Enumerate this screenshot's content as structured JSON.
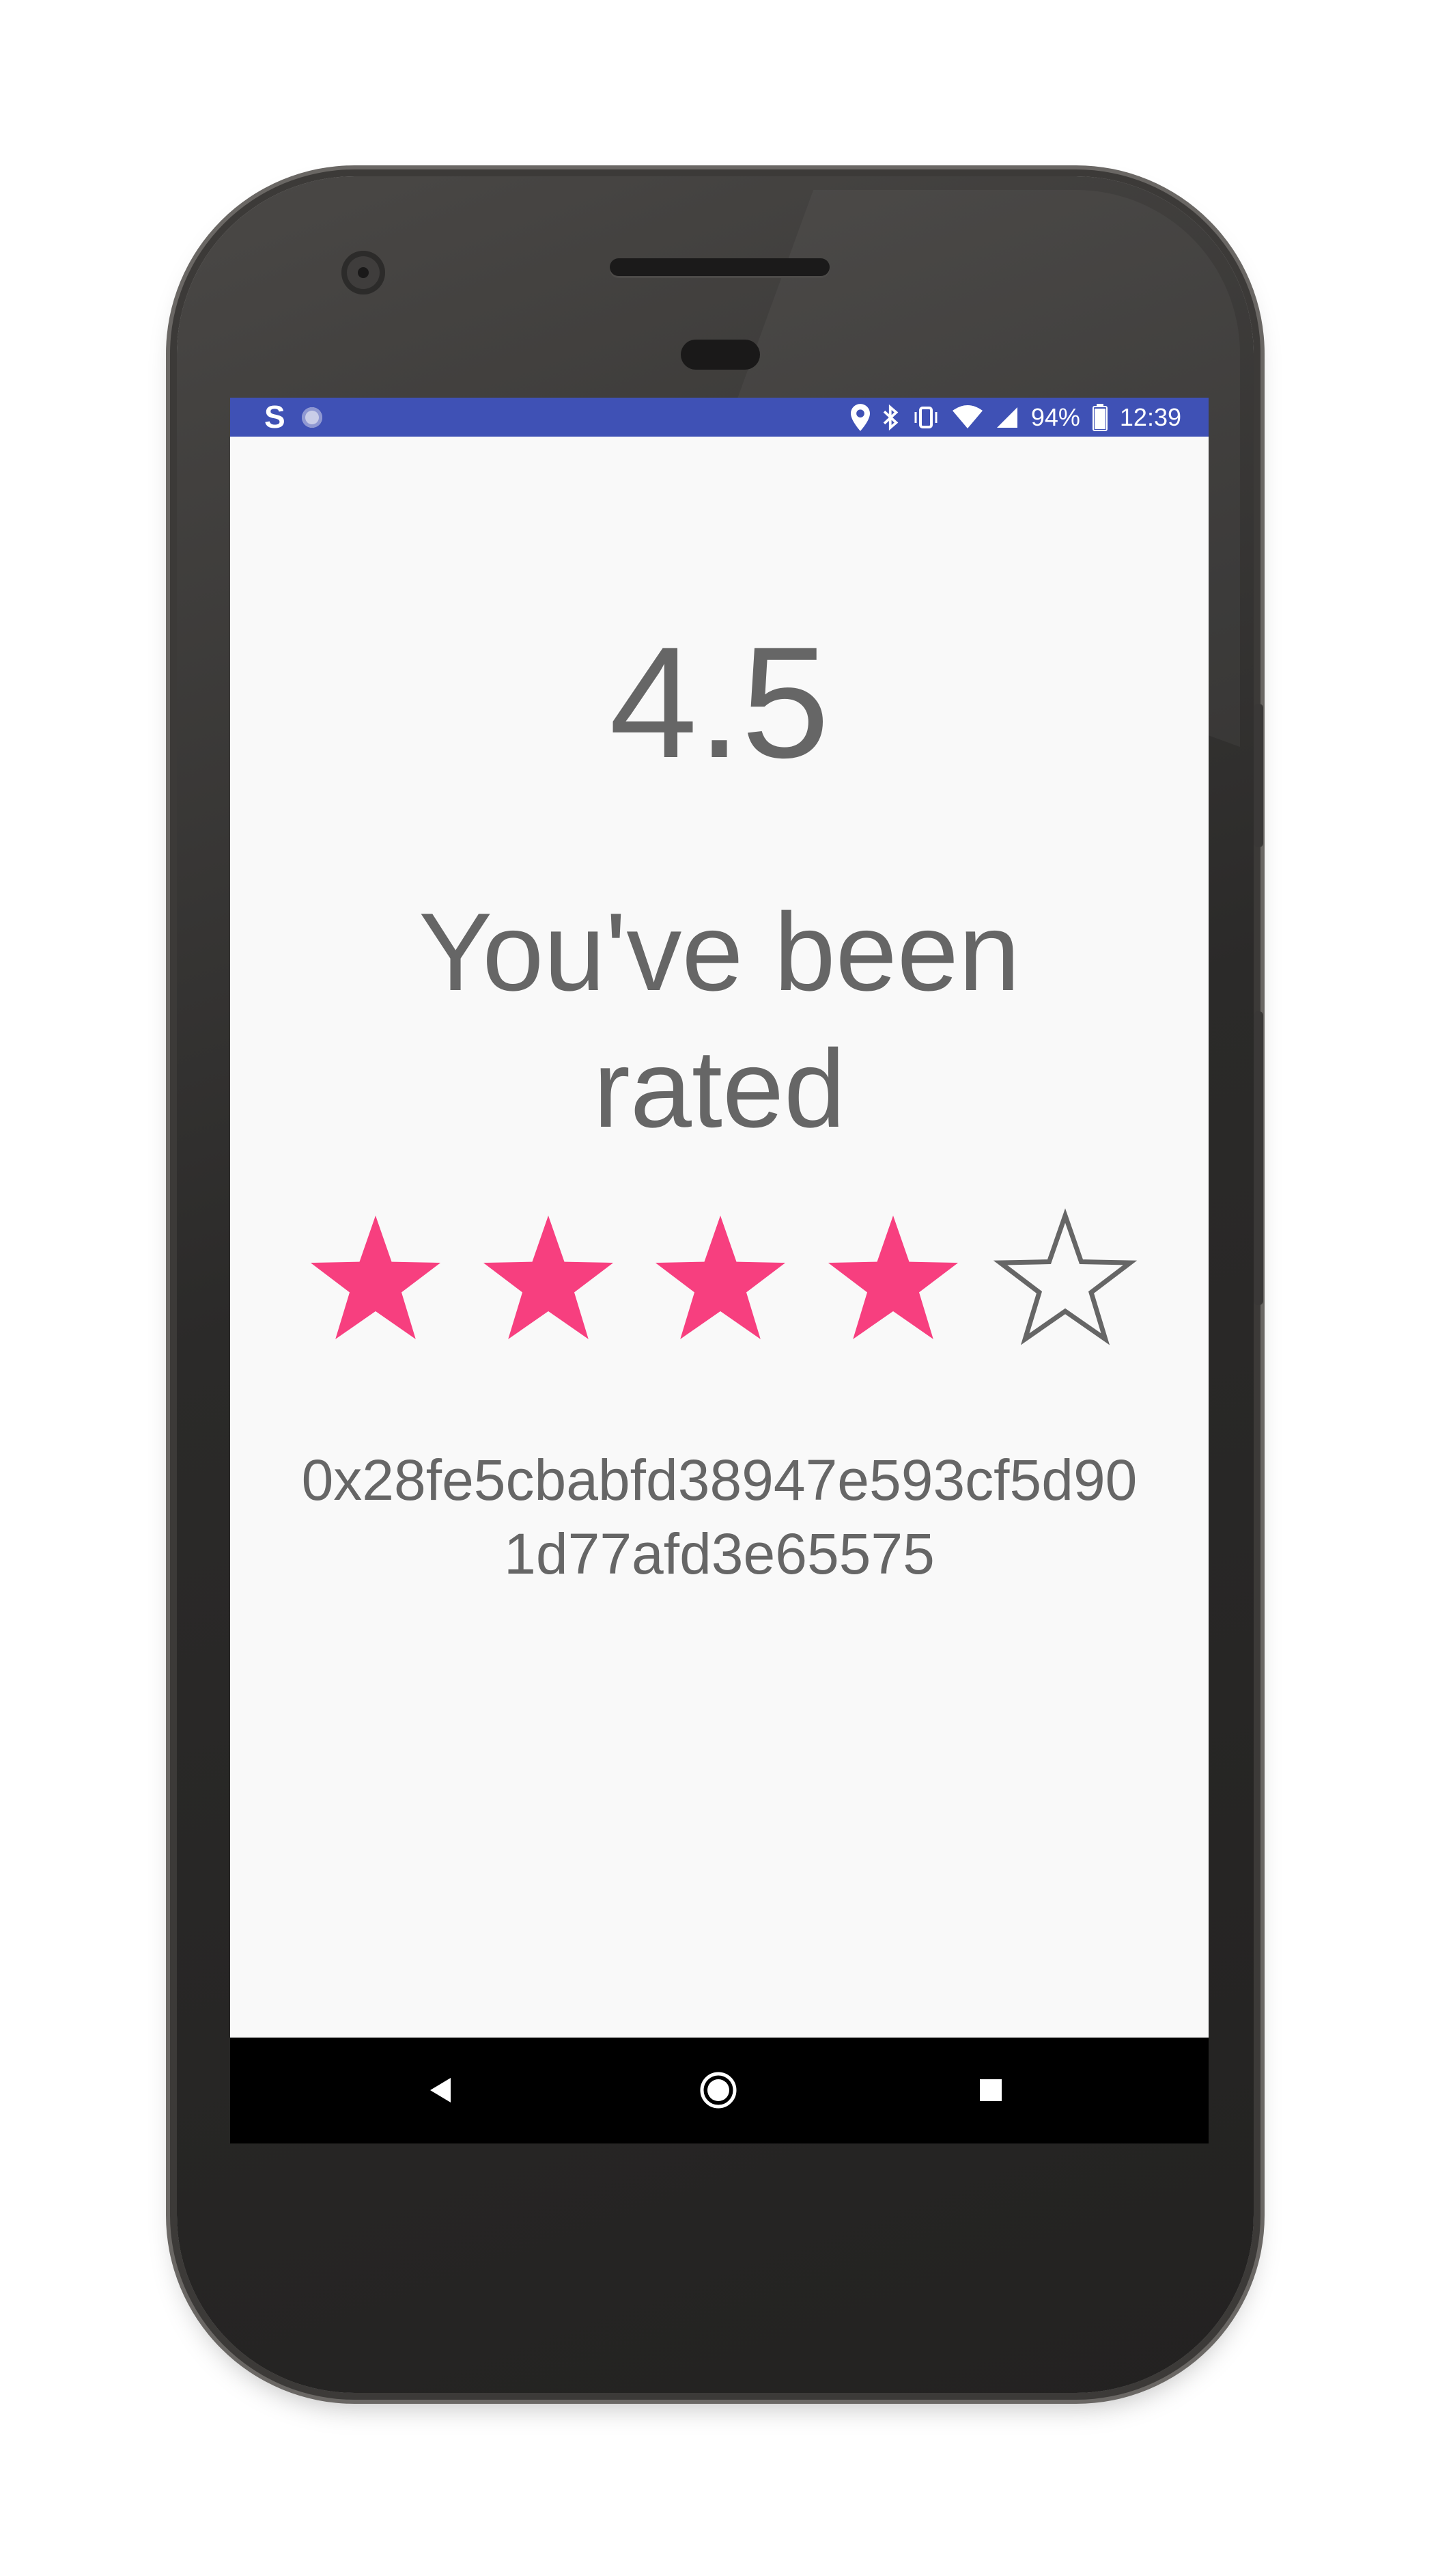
{
  "status_bar": {
    "battery_text": "94%",
    "time": "12:39",
    "app_letter": "S",
    "icons": [
      "s-notification-icon",
      "circle-notification-icon",
      "location-icon",
      "bluetooth-icon",
      "vibrate-icon",
      "wifi-icon",
      "cell-signal-icon",
      "battery-icon"
    ]
  },
  "main": {
    "rating_value": "4.5",
    "headline_line1": "You've been",
    "headline_line2": "rated",
    "rating_stars": {
      "filled": 4,
      "total": 5
    },
    "address_line1": "0x28fe5cbabfd38947e593cf5d90",
    "address_line2": "1d77afd3e65575"
  },
  "nav_bar": {
    "buttons": [
      "back-icon",
      "home-icon",
      "recents-icon"
    ]
  },
  "colors": {
    "status_bar": "#3f51b5",
    "star_filled": "#f73f7f",
    "text": "#666666",
    "screen_bg": "#f9f9f9"
  }
}
